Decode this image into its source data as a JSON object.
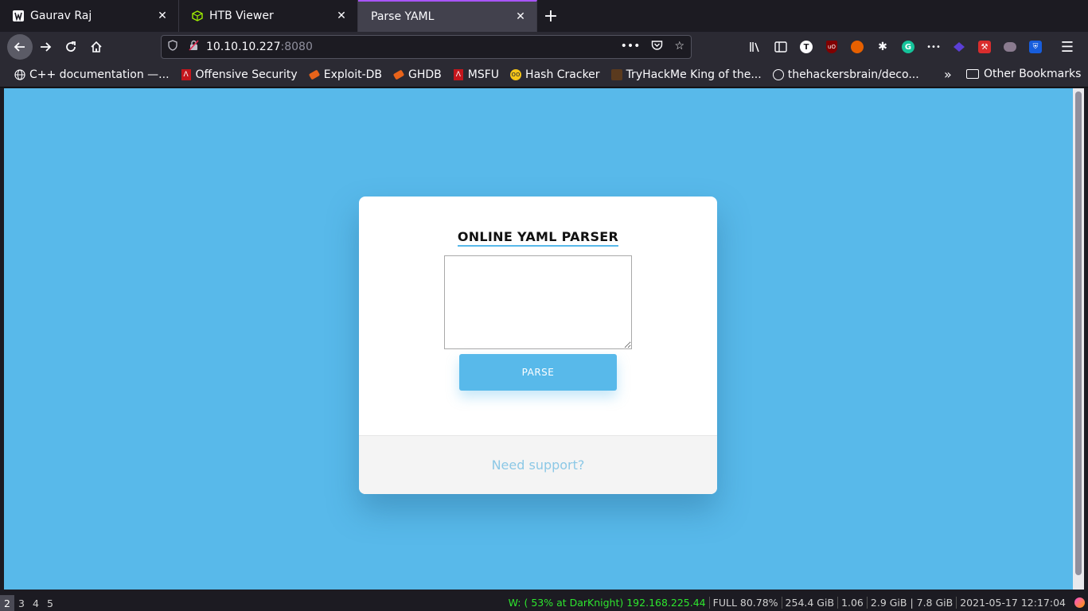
{
  "tabs": [
    {
      "title": "Gaurav Raj",
      "icon": "tab-favicon-icon",
      "active": false
    },
    {
      "title": "HTB Viewer",
      "icon": "cube-icon",
      "active": false
    },
    {
      "title": "Parse YAML",
      "icon": "",
      "active": true
    }
  ],
  "new_tab_label": "+",
  "url": {
    "host": "10.10.10.227",
    "port": ":8080"
  },
  "bookmarks": [
    {
      "label": "C++ documentation —...",
      "icon": "globe-icon"
    },
    {
      "label": "Offensive Security",
      "icon": "offsec-icon"
    },
    {
      "label": "Exploit-DB",
      "icon": "exploitdb-icon"
    },
    {
      "label": "GHDB",
      "icon": "ghdb-icon"
    },
    {
      "label": "MSFU",
      "icon": "msfu-icon"
    },
    {
      "label": "Hash Cracker",
      "icon": "hash-cracker-icon"
    },
    {
      "label": "TryHackMe King of the...",
      "icon": "tryhackme-icon"
    },
    {
      "label": "thehackersbrain/deco...",
      "icon": "github-icon"
    }
  ],
  "other_bookmarks": "Other Bookmarks",
  "page": {
    "title": "ONLINE YAML PARSER",
    "textarea_value": "",
    "parse_button": "PARSE",
    "support_link": "Need support?"
  },
  "statusbar": {
    "workspaces": [
      "2",
      "3",
      "4",
      "5"
    ],
    "active_workspace": "2",
    "wifi": "W: ( 53% at DarKnight) 192.168.225.44",
    "battery": "FULL 80.78%",
    "disk": "254.4 GiB",
    "load": "1.06",
    "memory": "2.9 GiB | 7.8 GiB",
    "datetime": "2021-05-17 12:17:04"
  },
  "colors": {
    "page_background": "#58b9ea",
    "accent": "#58b9ea",
    "support_link": "#8cc8e6"
  }
}
